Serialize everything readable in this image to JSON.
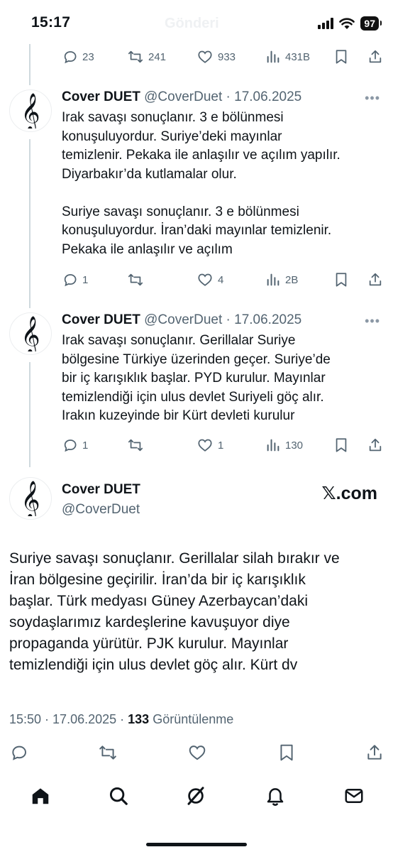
{
  "status_bar": {
    "time": "15:17",
    "battery": "97",
    "header_title": "Gönderi"
  },
  "top_actions": {
    "replies": "23",
    "retweets": "241",
    "likes": "933",
    "views": "431B"
  },
  "tweets": [
    {
      "name": "Cover DUET",
      "handle": "@CoverDuet",
      "date": "17.06.2025",
      "text": "Irak savaşı sonuçlanır. 3 e bölünmesi\nkonuşuluyordur. Suriye’deki mayınlar\ntemizlenir. Pekaka ile anlaşılır ve açılım yapılır.\nDiyarbakır’da kutlamalar olur.\n\nSuriye savaşı sonuçlanır. 3 e bölünmesi\nkonuşuluyordur. İran’daki mayınlar temizlenir.\nPekaka ile anlaşılır ve açılım",
      "replies": "1",
      "retweets": "",
      "likes": "4",
      "views": "2B"
    },
    {
      "name": "Cover DUET",
      "handle": "@CoverDuet",
      "date": "17.06.2025",
      "text": "Irak savaşı sonuçlanır. Gerillalar Suriye\nbölgesine Türkiye üzerinden geçer. Suriye’de\nbir iç karışıklık başlar. PYD kurulur. Mayınlar\ntemizlendiği için ulus devlet Suriyeli göç alır.\nIrakın kuzeyinde bir Kürt devleti kurulur",
      "replies": "1",
      "retweets": "",
      "likes": "1",
      "views": "130"
    }
  ],
  "main_tweet": {
    "name": "Cover DUET",
    "handle": "@CoverDuet",
    "source_logo": "𝕏.com",
    "text": "Suriye savaşı sonuçlanır. Gerillalar silah bırakır ve\nİran bölgesine geçirilir. İran’da bir iç karışıklık\nbaşlar. Türk medyası Güney Azerbaycan’daki\nsoydaşlarımız kardeşlerine kavuşuyor diye\npropaganda yürütür. PJK kurulur. Mayınlar\ntemizlendiği için ulus devlet göç alır. Kürt dv",
    "time": "15:50",
    "date": "17.06.2025",
    "views": "133",
    "views_label": "Görüntülenme"
  },
  "icons": {
    "avatar": "treble-clef-icon",
    "reply": "reply-icon",
    "retweet": "retweet-icon",
    "like": "heart-icon",
    "views": "views-icon",
    "bookmark": "bookmark-icon",
    "share": "share-icon"
  },
  "tab_bar": [
    "home-icon",
    "search-icon",
    "grok-icon",
    "notifications-icon",
    "messages-icon"
  ],
  "colors": {
    "text": "#0f1419",
    "secondary": "#536471",
    "thread_line": "#cfd9de"
  }
}
